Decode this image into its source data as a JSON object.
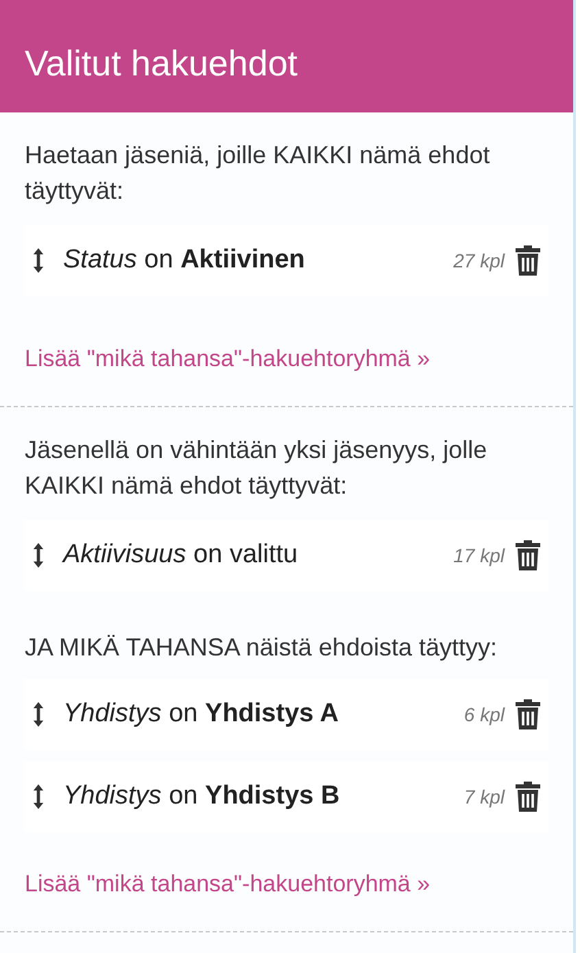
{
  "header": {
    "title": "Valitut hakuehdot"
  },
  "groups": [
    {
      "intro": "Haetaan jäseniä, joille KAIKKI nämä ehdot täyttyvät:",
      "conditions": [
        {
          "text": "*Status* on **Aktiivinen**",
          "count": "27 kpl"
        }
      ],
      "add_link": "Lisää \"mikä tahansa\"-hakuehtoryhmä »"
    },
    {
      "intro": "Jäsenellä on vähintään yksi jäsenyys, jolle KAIKKI nämä ehdot täyttyvät:",
      "conditions": [
        {
          "text": "*Aktiivisuus* on valittu",
          "count": "17 kpl"
        }
      ],
      "any_group": {
        "label": "JA MIKÄ TAHANSA näistä ehdoista täyttyy:",
        "conditions": [
          {
            "text": "*Yhdistys* on **Yhdistys A**",
            "count": "6 kpl"
          },
          {
            "text": "*Yhdistys* on **Yhdistys B**",
            "count": "7 kpl"
          }
        ]
      },
      "add_link": "Lisää \"mikä tahansa\"-hakuehtoryhmä »"
    }
  ]
}
